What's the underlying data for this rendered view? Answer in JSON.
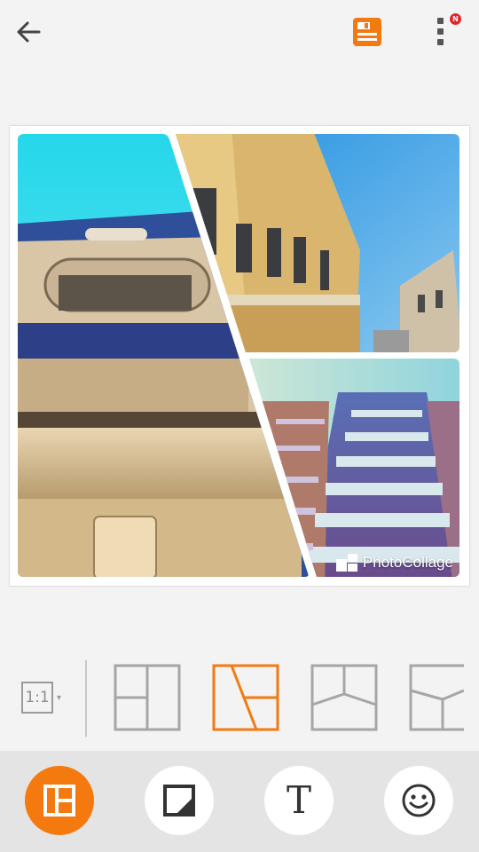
{
  "toolbar_top": {
    "back_icon": "arrow-left-icon",
    "save_icon": "save-icon",
    "more_icon": "more-vertical-icon",
    "badge_text": "N",
    "accent_color": "#f47a0f"
  },
  "collage": {
    "watermark_text": "PhotoCollage",
    "photos": [
      {
        "subject": "building facade, low angle, blue sky"
      },
      {
        "subject": "yellow classical building street view"
      },
      {
        "subject": "tall apartment building with balconies"
      }
    ]
  },
  "layout_selector": {
    "ratio_label": "1:1",
    "ratio_caret": "▾",
    "layouts": [
      {
        "name": "layout-grid-3",
        "selected": false
      },
      {
        "name": "layout-diagonal-3",
        "selected": true
      },
      {
        "name": "layout-y-split-3",
        "selected": false
      },
      {
        "name": "layout-cube-3",
        "selected": false
      }
    ]
  },
  "bottom_tools": [
    {
      "name": "layout-tool",
      "icon": "layout-icon",
      "active": true
    },
    {
      "name": "border-tool",
      "icon": "border-icon",
      "active": false
    },
    {
      "name": "text-tool",
      "icon": "text-icon",
      "label": "T",
      "active": false
    },
    {
      "name": "sticker-tool",
      "icon": "smiley-icon",
      "active": false
    }
  ]
}
